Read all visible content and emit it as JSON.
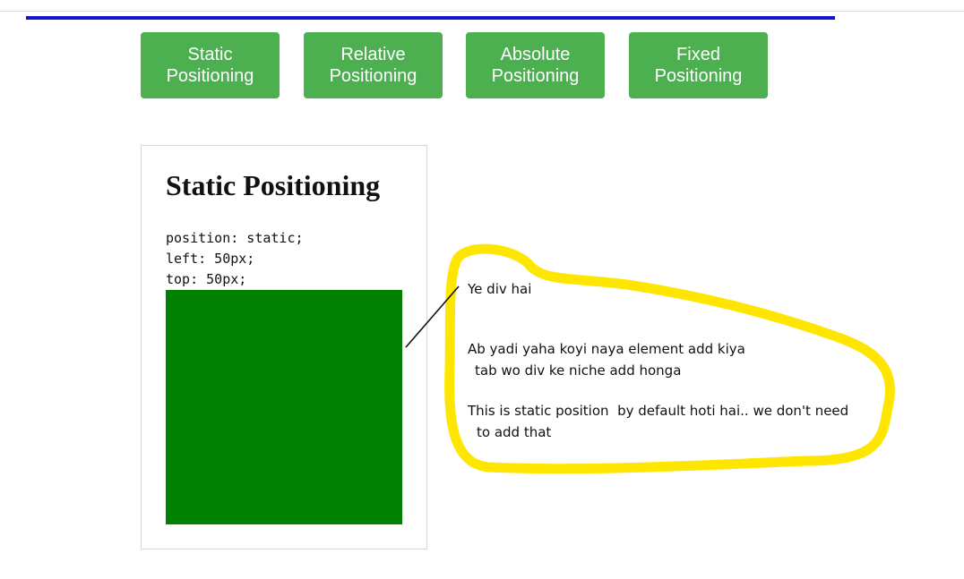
{
  "nav": {
    "buttons": [
      {
        "label": "Static Positioning"
      },
      {
        "label": "Relative Positioning"
      },
      {
        "label": "Absolute Positioning"
      },
      {
        "label": "Fixed Positioning"
      }
    ]
  },
  "demo": {
    "title": "Static Positioning",
    "code": [
      "position: static;",
      "left: 50px;",
      "top: 50px;"
    ],
    "box_color": "#008000"
  },
  "annotation": {
    "lines": [
      "Ye div hai",
      "Ab yadi yaha koyi naya element add kiya",
      "tab wo div ke niche add honga",
      "This is static position  by default hoti hai.. we don't need",
      "to add that"
    ],
    "highlight_color": "#ffe600"
  },
  "colors": {
    "button_bg": "#4caf50",
    "rule": "#1414d6"
  }
}
